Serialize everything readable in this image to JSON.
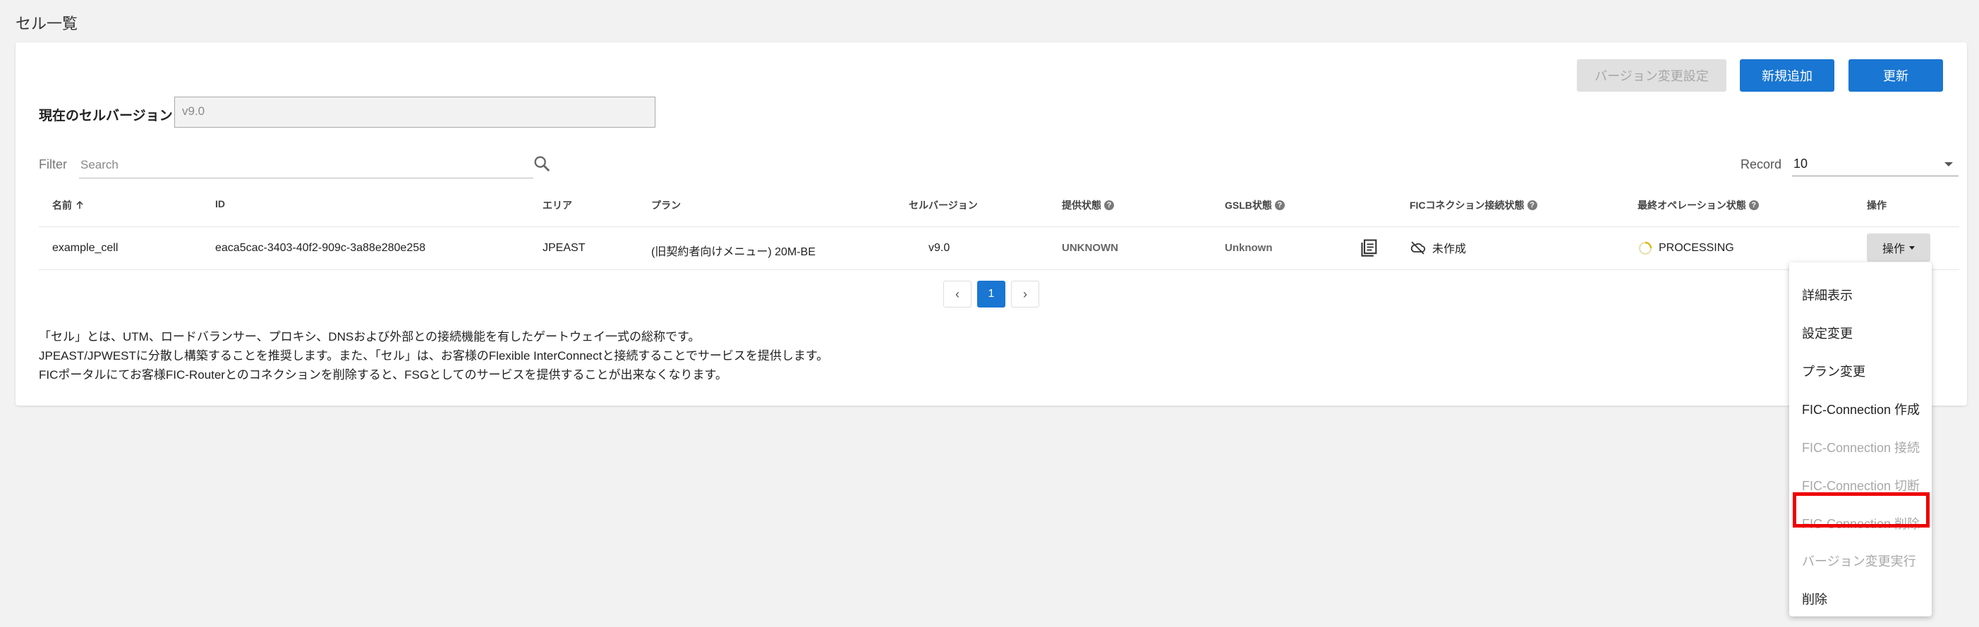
{
  "page_title": "セル一覧",
  "toolbar": {
    "version_setting": "バージョン変更設定",
    "add_new": "新規追加",
    "refresh": "更新"
  },
  "current_version": {
    "label": "現在のセルバージョン",
    "value": "v9.0"
  },
  "filter": {
    "label": "Filter",
    "placeholder": "Search"
  },
  "record": {
    "label": "Record",
    "value": "10"
  },
  "table": {
    "headers": {
      "name": "名前",
      "id": "ID",
      "area": "エリア",
      "plan": "プラン",
      "cell_version": "セルバージョン",
      "provide_status": "提供状態",
      "gslb_status": "GSLB状態",
      "fic_status": "FICコネクション接続状態",
      "last_op_status": "最終オペレーション状態",
      "ops": "操作"
    },
    "rows": [
      {
        "name": "example_cell",
        "id": "eaca5cac-3403-40f2-909c-3a88e280e258",
        "area": "JPEAST",
        "plan": "(旧契約者向けメニュー) 20M-BE",
        "cell_version": "v9.0",
        "provide_status": "UNKNOWN",
        "gslb_status": "Unknown",
        "fic_status": "未作成",
        "last_op_status": "PROCESSING",
        "ops_label": "操作"
      }
    ]
  },
  "pagination": {
    "current": "1",
    "prev": "‹",
    "next": "›"
  },
  "description": [
    "「セル」とは、UTM、ロードバランサー、プロキシ、DNSおよび外部との接続機能を有したゲートウェイ一式の総称です。",
    "JPEAST/JPWESTに分散し構築することを推奨します。また、「セル」は、お客様のFlexible InterConnectと接続することでサービスを提供します。",
    "FICポータルにてお客様FIC-Routerとのコネクションを削除すると、FSGとしてのサービスを提供することが出来なくなります。"
  ],
  "menu": [
    {
      "label": "詳細表示",
      "disabled": false
    },
    {
      "label": "設定変更",
      "disabled": false
    },
    {
      "label": "プラン変更",
      "disabled": false
    },
    {
      "label": "FIC-Connection 作成",
      "disabled": false
    },
    {
      "label": "FIC-Connection 接続",
      "disabled": true
    },
    {
      "label": "FIC-Connection 切断",
      "disabled": true
    },
    {
      "label": "FIC-Connection 削除",
      "disabled": true
    },
    {
      "label": "バージョン変更実行",
      "disabled": true
    },
    {
      "label": "削除",
      "disabled": false
    }
  ],
  "colors": {
    "primary": "#1976d2",
    "highlight": "#e00000"
  }
}
